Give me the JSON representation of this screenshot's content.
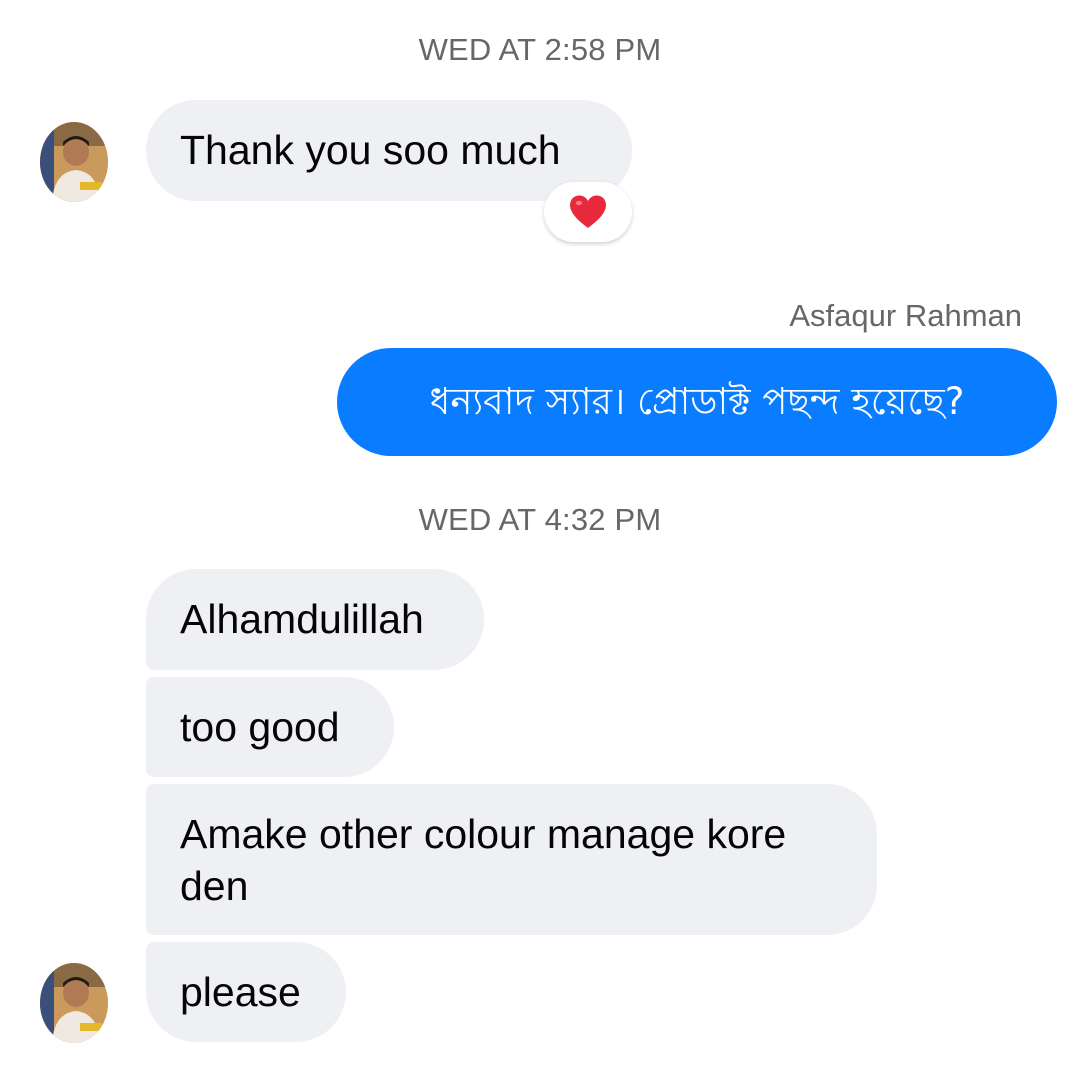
{
  "timestamps": {
    "first": "WED AT 2:58 PM",
    "second": "WED AT 4:32 PM"
  },
  "messages": {
    "incoming_1": "Thank you soo much",
    "reaction_icon": "heart-emoji",
    "outgoing_sender": "Asfaqur Rahman",
    "outgoing_1": "ধন্যবাদ স্যার। প্রোডাক্ট পছন্দ হয়েছে?",
    "incoming_group": {
      "line1": "Alhamdulillah",
      "line2": "too good",
      "line3": "Amake other colour manage kore den",
      "line4": "please"
    }
  },
  "colors": {
    "incoming_bubble": "#eff0f4",
    "outgoing_bubble": "#0a7cff",
    "timestamp": "#65676b",
    "reaction_heart": "#e8283b"
  }
}
